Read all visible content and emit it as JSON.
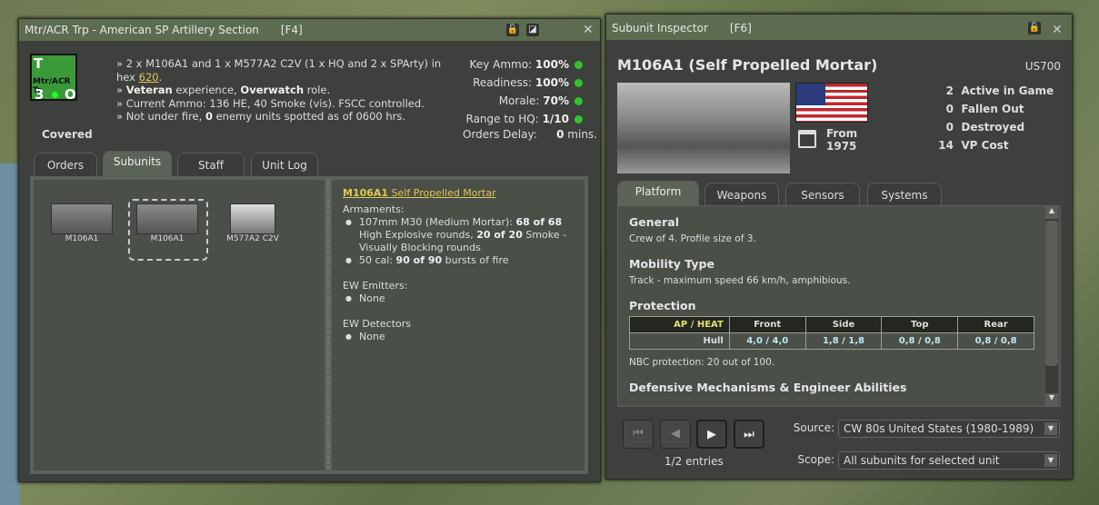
{
  "unit_window": {
    "title": "Mtr/ACR Trp - American SP Artillery Section",
    "hotkey": "[F4]",
    "counter": {
      "top": "T",
      "name": "Mtr/ACR Tr",
      "left": "3",
      "right": "O"
    },
    "posture": "Covered",
    "summary": {
      "line1a": "» 2 x M106A1 and 1 x M577A2 C2V (1 x HQ and 2 x SPArty) in hex ",
      "hex": "620",
      "line1b": ".",
      "line2a": "» ",
      "veteran": "Veteran",
      "line2b": " experience, ",
      "overwatch": "Overwatch",
      "line2c": " role.",
      "line3": "» Current Ammo: 136 HE, 40 Smoke (vis). FSCC controlled.",
      "line4a": "» Not under fire, ",
      "enemies": "0",
      "line4b": " enemy units spotted as of 0600 hrs."
    },
    "stats": [
      {
        "label": "Key Ammo:",
        "value": "100%"
      },
      {
        "label": "Readiness:",
        "value": "100%"
      },
      {
        "label": "Morale:",
        "value": "70%"
      },
      {
        "label": "Range to HQ:",
        "value": "1/10"
      }
    ],
    "orders_delay": {
      "label": "Orders Delay:",
      "value": "0",
      "unit": " mins."
    },
    "tabs": [
      "Orders",
      "Subunits",
      "Staff",
      "Unit Log"
    ],
    "subunits": [
      "M106A1",
      "M106A1",
      "M577A2 C2V"
    ],
    "detail": {
      "name": "M106A1",
      "type": "Self Propelled Mortar",
      "armaments_label": "Armaments:",
      "arm1a": "107mm M30 (Medium Mortar): ",
      "arm1b": "68 of 68",
      "arm1c": " High Explosive rounds, ",
      "arm1d": "20 of 20",
      "arm1e": " Smoke - Visually Blocking rounds",
      "arm2a": "50 cal: ",
      "arm2b": "90 of 90",
      "arm2c": " bursts of fire",
      "emitters_label": "EW Emitters:",
      "emitters": "None",
      "detectors_label": "EW Detectors",
      "detectors": "None"
    }
  },
  "inspector": {
    "title": "Subunit Inspector",
    "hotkey": "[F6]",
    "name": "M106A1 (Self Propelled Mortar)",
    "code": "US700",
    "from_label": "From",
    "from_year": "1975",
    "counts": [
      {
        "n": "2",
        "label": "Active in Game"
      },
      {
        "n": "0",
        "label": "Fallen Out"
      },
      {
        "n": "0",
        "label": "Destroyed"
      },
      {
        "n": "14",
        "label": "VP Cost"
      }
    ],
    "tabs": [
      "Platform",
      "Weapons",
      "Sensors",
      "Systems"
    ],
    "general_h": "General",
    "general": "Crew of 4. Profile size of 3.",
    "mobility_h": "Mobility Type",
    "mobility": "Track - maximum speed 66 km/h, amphibious.",
    "protection_h": "Protection",
    "prot_headers": [
      "AP / HEAT",
      "Front",
      "Side",
      "Top",
      "Rear"
    ],
    "prot_row": [
      "Hull",
      "4,0 / 4,0",
      "1,8 / 1,8",
      "0,8 / 0,8",
      "0,8 / 0,8"
    ],
    "nbc": "NBC protection: 20 out of 100.",
    "defensive_h": "Defensive Mechanisms & Engineer Abilities",
    "entries": "1/2 entries",
    "source_label": "Source:",
    "source": "CW 80s United States (1980-1989)",
    "scope_label": "Scope:",
    "scope": "All subunits for selected unit"
  }
}
